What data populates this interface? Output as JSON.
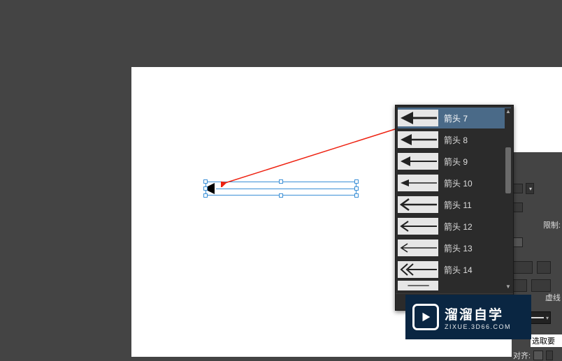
{
  "canvas": {
    "selected_arrow_name": "drawn-arrow-object"
  },
  "arrowhead_dropdown": {
    "items": [
      {
        "label": "箭头 7",
        "variant": "v7"
      },
      {
        "label": "箭头 8",
        "variant": "v8"
      },
      {
        "label": "箭头 9",
        "variant": "v9"
      },
      {
        "label": "箭头 10",
        "variant": "v10"
      },
      {
        "label": "箭头 11",
        "variant": "v11"
      },
      {
        "label": "箭头 12",
        "variant": "v12"
      },
      {
        "label": "箭头 13",
        "variant": "v13"
      },
      {
        "label": "箭头 14",
        "variant": "v14"
      }
    ],
    "selected_index": 0
  },
  "props": {
    "limit_label": "限制:",
    "dash_label": "虚线",
    "align_label": "对齐:",
    "hint_text": "选取要应"
  },
  "watermark": {
    "line1": "溜溜自学",
    "line2": "ZIXUE.3D66.COM"
  }
}
